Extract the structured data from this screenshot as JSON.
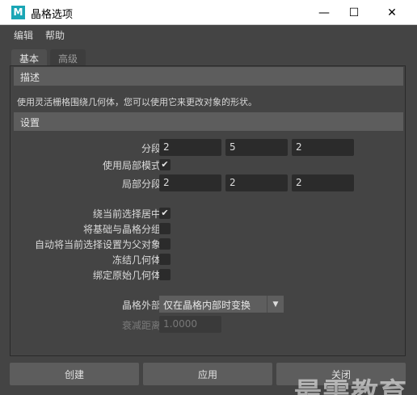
{
  "window": {
    "app_icon": "M",
    "title": "晶格选项",
    "min_glyph": "—",
    "max_glyph": "☐",
    "close_glyph": "✕"
  },
  "menu": {
    "items": [
      "编辑",
      "帮助"
    ]
  },
  "tabs": [
    {
      "label": "基本",
      "active": true
    },
    {
      "label": "高级",
      "active": false
    }
  ],
  "describe": {
    "header": "描述",
    "text": "使用灵活栅格围绕几何体，您可以使用它来更改对象的形状。"
  },
  "settings": {
    "header": "设置",
    "divisions": {
      "label": "分段:",
      "values": [
        "2",
        "5",
        "2"
      ]
    },
    "use_local_mode": {
      "label": "使用局部模式:",
      "checked": true,
      "check_glyph": "✔"
    },
    "local_divisions": {
      "label": "局部分段:",
      "values": [
        "2",
        "2",
        "2"
      ]
    },
    "center_around_selection": {
      "label": "绕当前选择居中:",
      "checked": true,
      "check_glyph": "✔"
    },
    "group_base_and_lattice": {
      "label": "将基础与晶格分组:",
      "checked": false
    },
    "parent_to_selection": {
      "label": "自动将当前选择设置为父对象:",
      "checked": false
    },
    "freeze_geometry": {
      "label": "冻结几何体:",
      "checked": false
    },
    "bind_original_geometry": {
      "label": "绑定原始几何体:",
      "checked": false
    },
    "outside_lattice": {
      "label": "晶格外部:",
      "value": "仅在晶格内部时变换",
      "arrow_glyph": "▼"
    },
    "falloff_distance": {
      "label": "衰减距离:",
      "value": "1.0000",
      "enabled": false
    }
  },
  "buttons": {
    "create": "创建",
    "apply": "应用",
    "close": "关闭"
  },
  "watermark": "最需教育",
  "colors": {
    "dialog_bg": "#444444",
    "section_bg": "#5d5d5d",
    "field_bg": "#2b2b2b",
    "accent_icon": "#1aa6b5"
  }
}
